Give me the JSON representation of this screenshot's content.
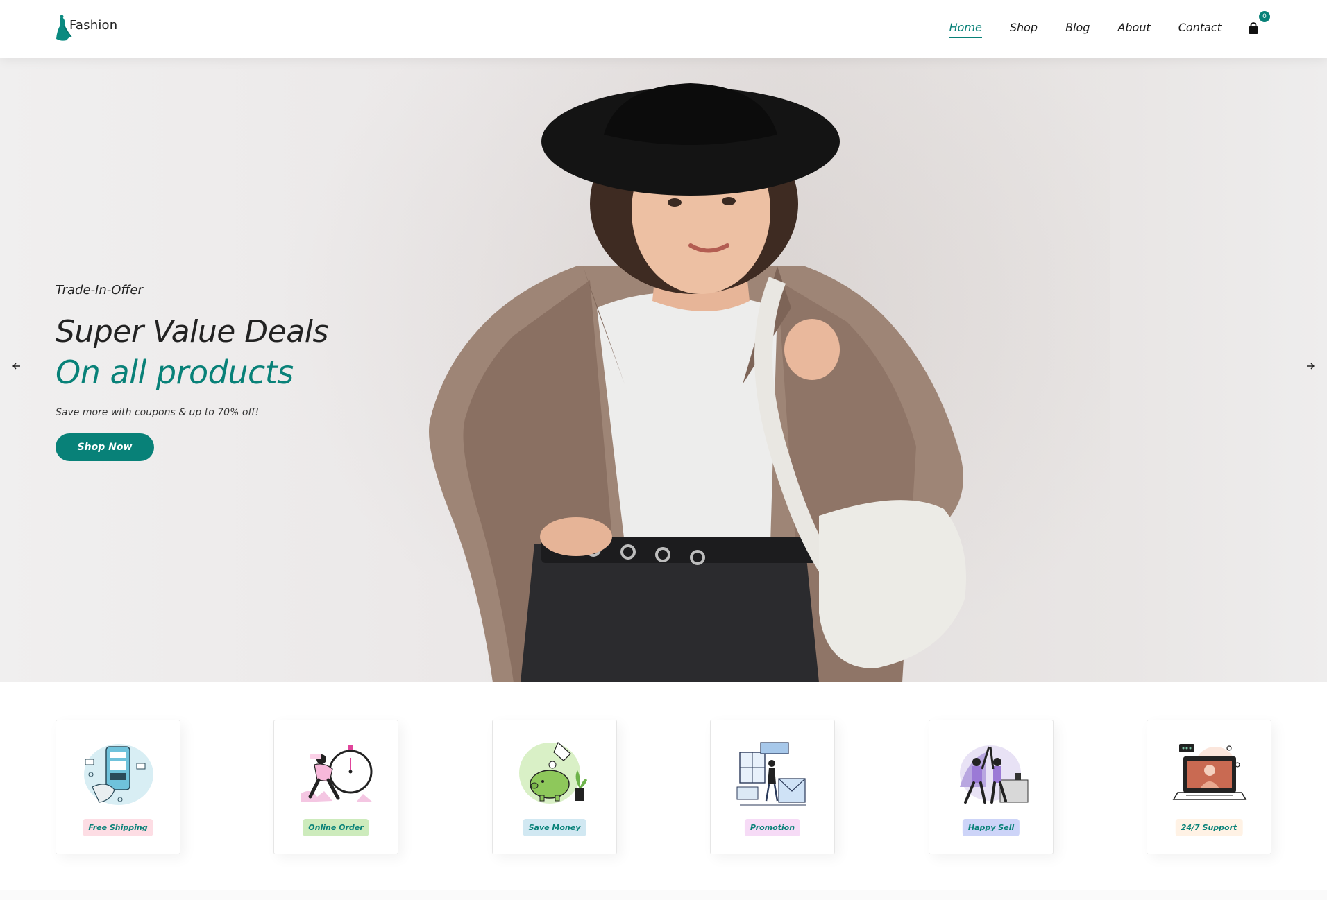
{
  "header": {
    "logo_text": "Fashion",
    "nav": [
      "Home",
      "Shop",
      "Blog",
      "About",
      "Contact"
    ],
    "active_nav": "Home",
    "cart_count": "0",
    "accent_color": "#088178"
  },
  "hero": {
    "eyebrow": "Trade-In-Offer",
    "title_line1": "Super Value Deals",
    "title_line2": "On all products",
    "subtitle": "Save more with coupons & up to 70% off!",
    "button_label": "Shop Now"
  },
  "features": [
    {
      "label": "Free Shipping",
      "bg": "#fddde4"
    },
    {
      "label": "Online Order",
      "bg": "#cdebbc"
    },
    {
      "label": "Save Money",
      "bg": "#d1e8f2"
    },
    {
      "label": "Promotion",
      "bg": "#f6dbf6"
    },
    {
      "label": "Happy Sell",
      "bg": "#cdd4f8"
    },
    {
      "label": "24/7 Support",
      "bg": "#fff2e5"
    }
  ]
}
